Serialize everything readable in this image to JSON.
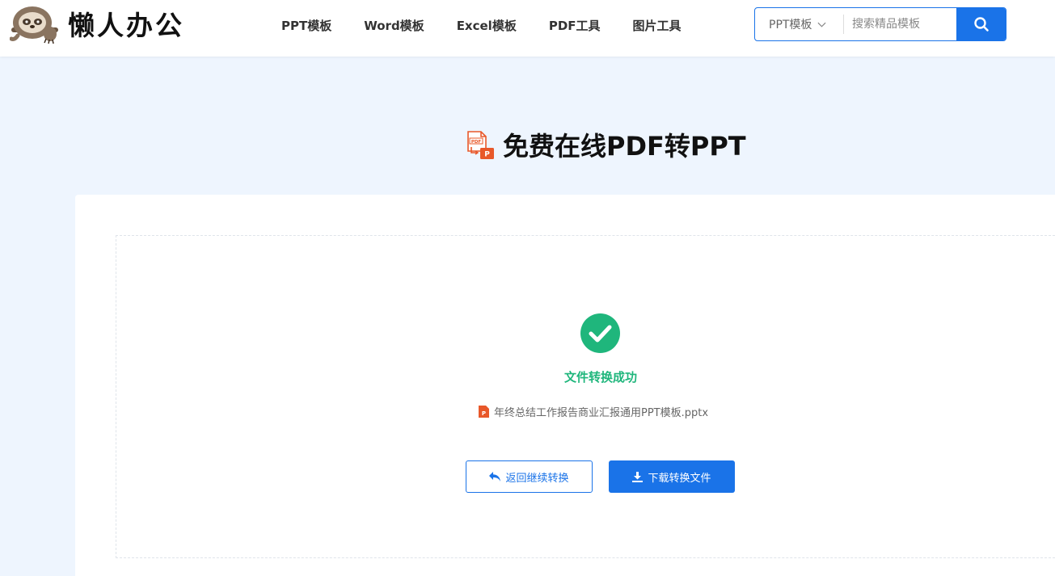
{
  "brand": {
    "name": "懒人办公"
  },
  "nav": {
    "items": [
      "PPT模板",
      "Word模板",
      "Excel模板",
      "PDF工具",
      "图片工具"
    ]
  },
  "search": {
    "type": "PPT模板",
    "placeholder": "搜索精品模板"
  },
  "page": {
    "title": "免费在线PDF转PPT"
  },
  "result": {
    "status": "文件转换成功",
    "file_name": "年终总结工作报告商业汇报通用PPT模板.pptx",
    "back_label": "返回继续转换",
    "download_label": "下载转换文件"
  },
  "colors": {
    "accent": "#1a73e8",
    "success": "#1fb67c",
    "page_bg": "#eef5fe",
    "ppt_orange": "#e8582a"
  }
}
